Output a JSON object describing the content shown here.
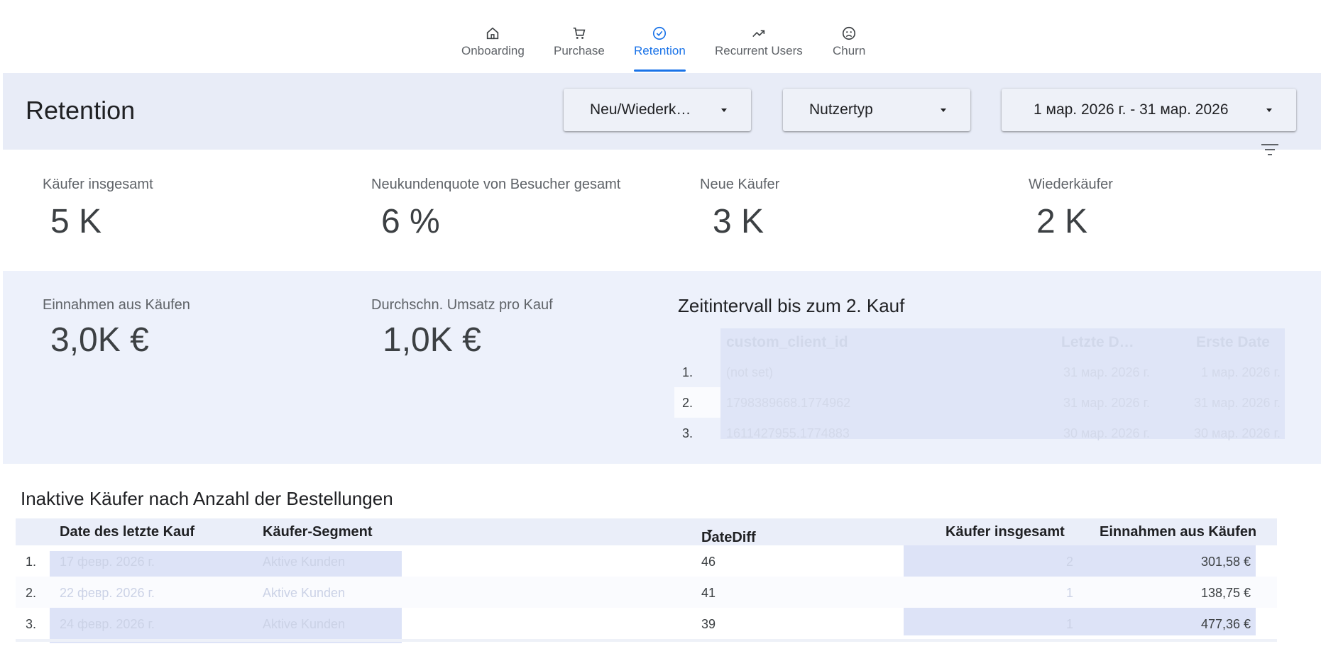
{
  "nav": {
    "tabs": [
      {
        "label": "Onboarding",
        "icon": "home-icon"
      },
      {
        "label": "Purchase",
        "icon": "cart-icon"
      },
      {
        "label": "Retention",
        "icon": "check-circle-icon",
        "active": true
      },
      {
        "label": "Recurrent Users",
        "icon": "trending-up-icon"
      },
      {
        "label": "Churn",
        "icon": "sad-face-icon"
      }
    ]
  },
  "header": {
    "title": "Retention",
    "filters": {
      "customer_type": "Neu/Wiederk…",
      "user_type": "Nutzertyp",
      "date_range": "1 мар. 2026 г. - 31 мар. 2026"
    }
  },
  "kpis": [
    {
      "label": "Käufer insgesamt",
      "value": "5 K"
    },
    {
      "label": "Neukundenquote von Besucher gesamt",
      "value": "6 %"
    },
    {
      "label": "Neue Käufer",
      "value": "3 K"
    },
    {
      "label": "Wiederkäufer",
      "value": "2 K"
    }
  ],
  "revenue_kpis": [
    {
      "label": "Einnahmen aus Käufen",
      "value": "3,0K €"
    },
    {
      "label": "Durchschn. Umsatz pro Kauf",
      "value": "1,0K €"
    }
  ],
  "interval_table": {
    "title": "Zeitintervall bis zum 2. Kauf",
    "columns": [
      "custom_client_id",
      "Letzte D…",
      "Erste Date"
    ],
    "rows": [
      {
        "num": "1.",
        "id": "(not set)",
        "last": "31 мар. 2026 г.",
        "first": "1 мар. 2026 г."
      },
      {
        "num": "2.",
        "id": "1798389668.1774962",
        "last": "31 мар. 2026 г.",
        "first": "31 мар. 2026 г."
      },
      {
        "num": "3.",
        "id": "1611427955.1774883",
        "last": "30 мар. 2026 г.",
        "first": "30 мар. 2026 г."
      }
    ]
  },
  "inactive_table": {
    "title": "Inaktive Käufer nach Anzahl der Bestellungen",
    "columns": [
      "Date des letzte Kauf",
      "Käufer-Segment",
      "DateDiff",
      "Käufer insgesamt",
      "Einnahmen aus Käufen"
    ],
    "rows": [
      {
        "num": "1.",
        "date": "17 февр. 2026 г.",
        "segment": "Aktive Kunden",
        "diff": "46",
        "buyers": "2",
        "revenue": "301,58 €"
      },
      {
        "num": "2.",
        "date": "22 февр. 2026 г.",
        "segment": "Aktive Kunden",
        "diff": "41",
        "buyers": "1",
        "revenue": "138,75 €"
      },
      {
        "num": "3.",
        "date": "24 февр. 2026 г.",
        "segment": "Aktive Kunden",
        "diff": "39",
        "buyers": "1",
        "revenue": "477,36 €"
      }
    ]
  }
}
